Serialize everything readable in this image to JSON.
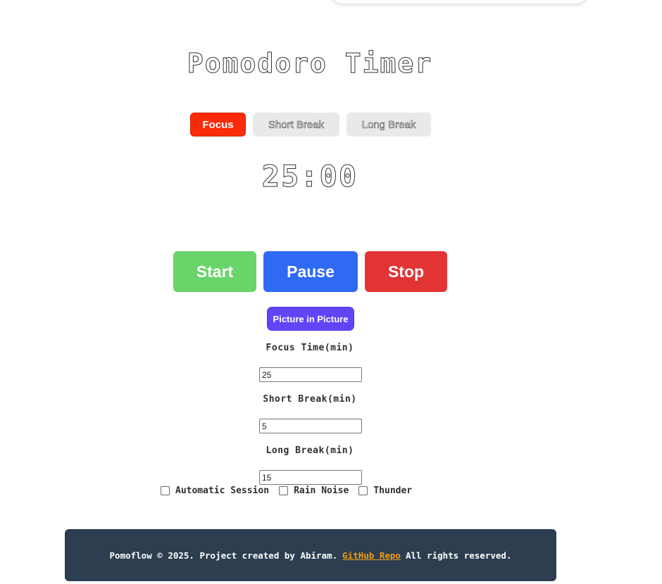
{
  "header": {
    "title": "Pomodoro Timer"
  },
  "modes": {
    "focus": "Focus",
    "short_break": "Short Break",
    "long_break": "Long Break",
    "active": "Focus"
  },
  "timer": {
    "display": "25:00"
  },
  "controls": {
    "start": "Start",
    "pause": "Pause",
    "stop": "Stop",
    "picture_in_picture": "Picture in Picture"
  },
  "settings": {
    "focus_label": "Focus Time(min)",
    "focus_value": "25",
    "short_label": "Short Break(min)",
    "short_value": "5",
    "long_label": "Long Break(min)",
    "long_value": "15"
  },
  "options": [
    {
      "label": "Automatic Session",
      "checked": false
    },
    {
      "label": "Rain Noise",
      "checked": false
    },
    {
      "label": "Thunder",
      "checked": false
    }
  ],
  "footer": {
    "text_before": "Pomoflow © 2025. Project created by Abiram.",
    "link_text": "GitHub Repo",
    "text_after": "All rights reserved."
  },
  "colors": {
    "focus_tab": "#fa2b08",
    "inactive_tab": "#e9e9e9",
    "start": "#6ad46a",
    "pause": "#2f6af2",
    "stop": "#e23434",
    "picture_in_picture": "#6046f6",
    "footer_bg": "#2c3e50",
    "footer_link": "#f39c12"
  }
}
